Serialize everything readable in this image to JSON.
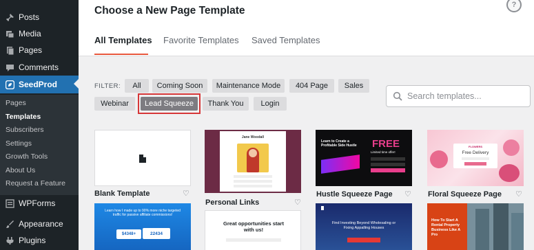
{
  "sidebar": {
    "items": [
      {
        "label": "Posts",
        "icon": "pin-icon"
      },
      {
        "label": "Media",
        "icon": "media-icon"
      },
      {
        "label": "Pages",
        "icon": "page-icon"
      },
      {
        "label": "Comments",
        "icon": "comment-icon"
      },
      {
        "label": "SeedProd",
        "icon": "seedprod-icon"
      },
      {
        "label": "WPForms",
        "icon": "wpforms-icon"
      },
      {
        "label": "Appearance",
        "icon": "brush-icon"
      },
      {
        "label": "Plugins",
        "icon": "plugin-icon"
      }
    ],
    "submenu": [
      "Pages",
      "Templates",
      "Subscribers",
      "Settings",
      "Growth Tools",
      "About Us",
      "Request a Feature"
    ]
  },
  "header": {
    "title": "Choose a New Page Template",
    "help": "?",
    "tabs": [
      "All Templates",
      "Favorite Templates",
      "Saved Templates"
    ]
  },
  "filter": {
    "label": "FILTER:",
    "chips": [
      "All",
      "Coming Soon",
      "Maintenance Mode",
      "404 Page",
      "Sales",
      "Webinar",
      "Lead Squeeze",
      "Thank You",
      "Login"
    ],
    "selected": "Lead Squeeze"
  },
  "search": {
    "placeholder": "Search templates..."
  },
  "templates": [
    {
      "name": "Blank Template"
    },
    {
      "name": "Personal Links",
      "preview_title": "Jane Woodall"
    },
    {
      "name": "Hustle Squeeze Page",
      "preview_headline": "Learn to Create a Profitable Side Hustle",
      "preview_badge": "FREE",
      "preview_sub": "Limited time offer!"
    },
    {
      "name": "Floral Squeeze Page",
      "preview_brand": "FLOWERS",
      "preview_headline": "Free Delivery"
    },
    {
      "name": "",
      "preview_headline": "Learn how I made up to 90% more niche targeted traffic for passive affiliate commissions!",
      "preview_stats": [
        "$4348+",
        "22434"
      ]
    },
    {
      "name": "",
      "preview_headline": "Great opportunities start with us!"
    },
    {
      "name": "",
      "preview_headline": "Find Investing Beyond Wholesaling or Fixing Appalling Houses"
    },
    {
      "name": "",
      "preview_headline": "How To Start A Rental Property Business Like A Pro"
    }
  ],
  "colors": {
    "accent": "#2271b1",
    "tab_underline": "#e8563c",
    "selection_outline": "#d63638",
    "sidebar_bg": "#1d2327"
  }
}
